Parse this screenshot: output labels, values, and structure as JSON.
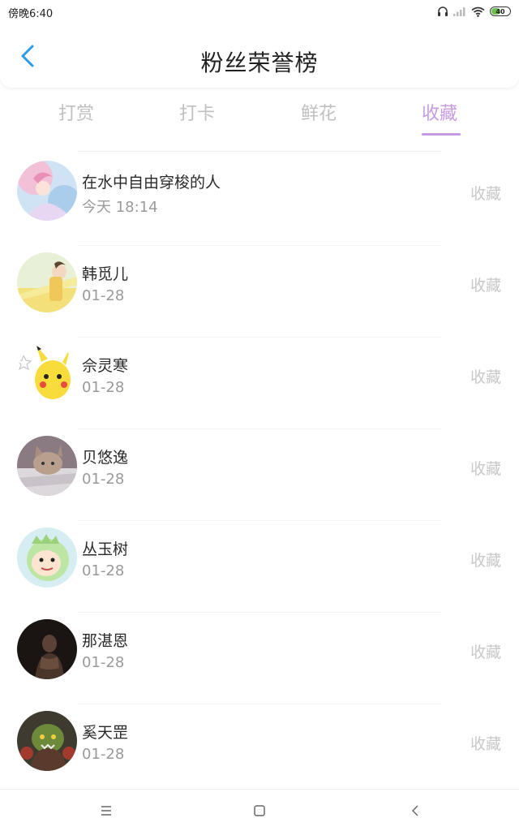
{
  "status_bar": {
    "time": "傍晚6:40",
    "battery": "40",
    "icons": [
      "headphones-icon",
      "signal-icon",
      "wifi-icon",
      "battery-icon"
    ]
  },
  "header": {
    "title": "粉丝荣誉榜",
    "back_icon": "chevron-left-icon"
  },
  "tabs": [
    {
      "label": "打赏",
      "active": false
    },
    {
      "label": "打卡",
      "active": false
    },
    {
      "label": "鲜花",
      "active": false
    },
    {
      "label": "收藏",
      "active": true
    }
  ],
  "list": {
    "items": [
      {
        "name": "在水中自由穿梭的人",
        "date": "今天 18:14",
        "action": "收藏"
      },
      {
        "name": "韩觅儿",
        "date": "01-28",
        "action": "收藏"
      },
      {
        "name": "佘灵寒",
        "date": "01-28",
        "action": "收藏"
      },
      {
        "name": "贝悠逸",
        "date": "01-28",
        "action": "收藏"
      },
      {
        "name": "丛玉树",
        "date": "01-28",
        "action": "收藏"
      },
      {
        "name": "那湛恩",
        "date": "01-28",
        "action": "收藏"
      },
      {
        "name": "奚天罡",
        "date": "01-28",
        "action": "收藏"
      }
    ]
  },
  "nav_bar": {
    "icons": [
      "menu-icon",
      "home-square-icon",
      "back-arrow-icon"
    ]
  },
  "colors": {
    "accent": "#c79be0",
    "back_arrow": "#2b9be8",
    "muted": "#c8c8c8"
  }
}
